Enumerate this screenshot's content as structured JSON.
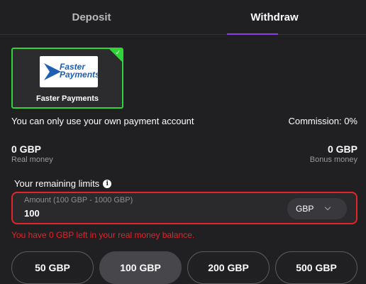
{
  "tabs": {
    "deposit": "Deposit",
    "withdraw": "Withdraw",
    "active": "withdraw"
  },
  "method": {
    "logo_text_1": "Faster",
    "logo_text_2": "Payments",
    "label": "Faster Payments",
    "selected": true
  },
  "notice": "You can only use your own payment account",
  "commission": "Commission: 0%",
  "balances": {
    "real_amount": "0 GBP",
    "real_label": "Real money",
    "bonus_amount": "0 GBP",
    "bonus_label": "Bonus money"
  },
  "limits": {
    "heading": "Your remaining limits",
    "info_glyph": "i"
  },
  "amount": {
    "label": "Amount (100 GBP - 1000 GBP)",
    "value": "100",
    "currency": "GBP"
  },
  "error": "You have 0 GBP left in your real money balance.",
  "quick_amounts": [
    "50 GBP",
    "100 GBP",
    "200 GBP",
    "500 GBP"
  ],
  "colors": {
    "accent": "#8a3ee8",
    "selected_border": "#31d33a",
    "error": "#e3242b"
  }
}
